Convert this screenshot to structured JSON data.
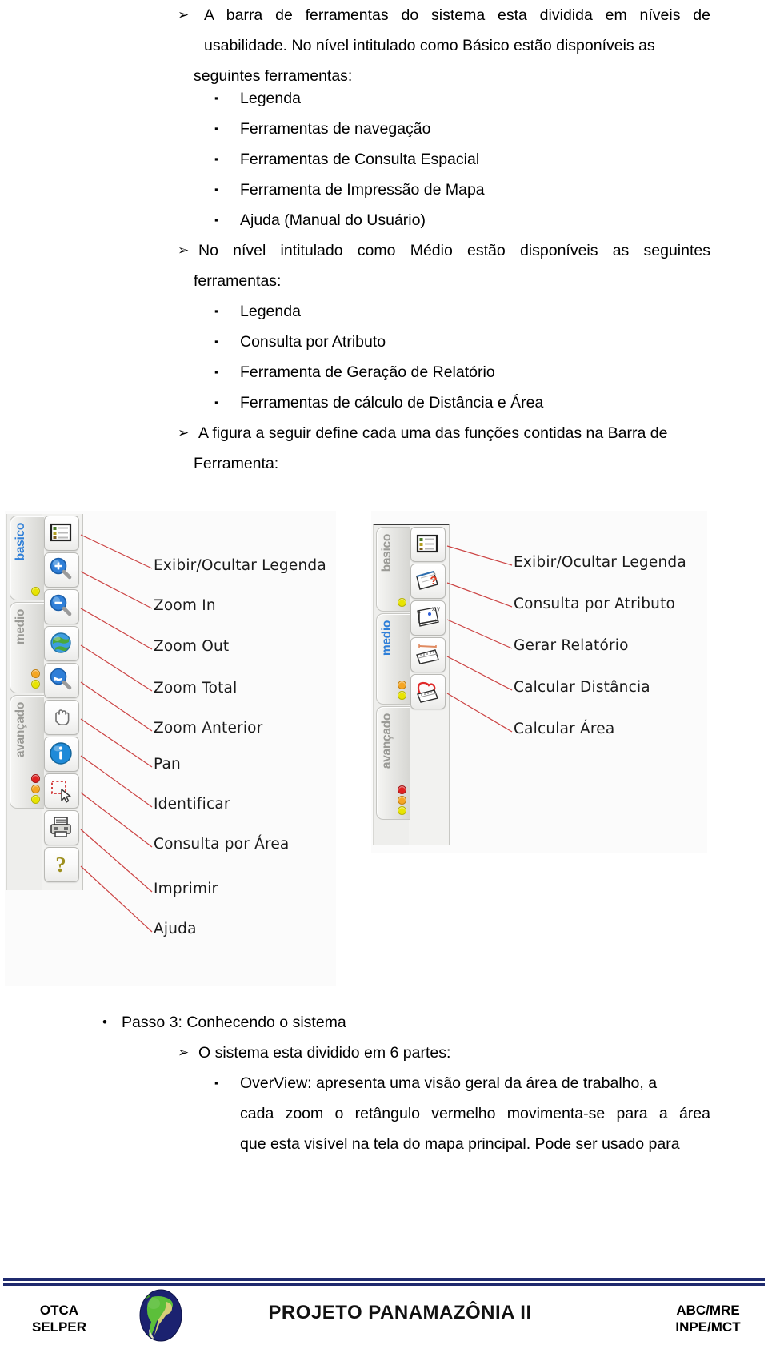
{
  "document": {
    "body": {
      "p1": {
        "lines": [
          "A barra de ferramentas do sistema esta dividida em níveis de"
        ],
        "line2_pre": "usabilidade. No nível intitulado como ",
        "line2_bold": "Básico",
        "line2_post": " estão disponíveis as",
        "line3": "seguintes ferramentas:"
      },
      "basic_tools": [
        "Legenda",
        "Ferramentas de navegação",
        "Ferramentas de Consulta Espacial",
        "Ferramenta de Impressão de Mapa",
        "Ajuda (Manual do Usuário)"
      ],
      "p2": {
        "pre": "No nível intitulado como ",
        "bold": "Médio",
        "post": " estão disponíveis as seguintes",
        "line2": "ferramentas:"
      },
      "medium_tools": [
        "Legenda",
        "Consulta por Atributo",
        "Ferramenta de Geração de Relatório",
        "Ferramentas de cálculo de Distância e Área"
      ],
      "p3": {
        "line1": "A figura a seguir define cada uma das funções contidas na Barra de",
        "line2": "Ferramenta:"
      },
      "p4_dot": "Passo 3: Conhecendo o sistema",
      "p4_arrow": "O sistema esta dividido em 6 partes:",
      "p5": {
        "bold": "OverView",
        "line1_post": ": apresenta uma visão geral da área de trabalho, a",
        "line2": "cada zoom o retângulo vermelho movimenta-se para a área",
        "line3": "que esta visível na tela do mapa principal. Pode ser usado para"
      },
      "bullets": {
        "arrow": "➢",
        "square": "▪",
        "dot": "•"
      }
    },
    "figure": {
      "left_toolbar": {
        "tabs": [
          {
            "label": "basico",
            "active": true,
            "dots": [
              "y"
            ]
          },
          {
            "label": "medio",
            "active": false,
            "dots": [
              "o",
              "y"
            ]
          },
          {
            "label": "avançado",
            "active": false,
            "dots": [
              "r",
              "o",
              "y"
            ]
          }
        ],
        "buttons": [
          "legend-icon",
          "zoom-in-icon",
          "zoom-out-icon",
          "globe-icon",
          "zoom-previous-icon",
          "pan-hand-icon",
          "identify-info-icon",
          "select-area-icon",
          "printer-icon",
          "help-question-icon"
        ],
        "labels": [
          "Exibir/Ocultar Legenda",
          "Zoom In",
          "Zoom Out",
          "Zoom Total",
          "Zoom Anterior",
          "Pan",
          "Identificar",
          "Consulta por Área",
          "Imprimir",
          "Ajuda"
        ]
      },
      "right_toolbar": {
        "tabs": [
          {
            "label": "basico",
            "active": false,
            "dots": [
              "y"
            ]
          },
          {
            "label": "medio",
            "active": true,
            "dots": [
              "o",
              "y"
            ]
          },
          {
            "label": "avançado",
            "active": false,
            "dots": [
              "r",
              "o",
              "y"
            ]
          }
        ],
        "buttons": [
          "legend-icon",
          "attribute-query-icon",
          "xy-graph-icon",
          "measure-distance-icon",
          "measure-area-icon"
        ],
        "labels": [
          "Exibir/Ocultar Legenda",
          "Consulta por Atributo",
          "Gerar Relatório",
          "Calcular Distância",
          "Calcular Área"
        ]
      }
    },
    "footer": {
      "left": "OTCA\nSELPER",
      "title": "PROJETO PANAMAZÔNIA II",
      "right": "ABC/MRE\nINPE/MCT",
      "logo": "south-america-globe-logo"
    }
  },
  "colors": {
    "accent_blue": "#2f7fd8",
    "footer_rule": "#1f2a6e",
    "leader_line": "#cc4444",
    "tab_inactive": "#9a9a96"
  }
}
